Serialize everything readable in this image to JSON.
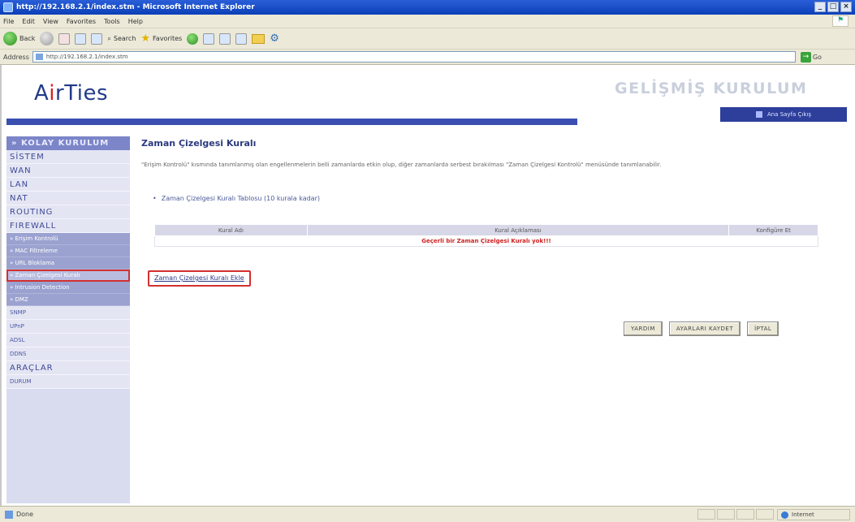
{
  "window": {
    "title": "http://192.168.2.1/index.stm - Microsoft Internet Explorer",
    "controls": [
      "_",
      "□",
      "×"
    ]
  },
  "menu": [
    "File",
    "Edit",
    "View",
    "Favorites",
    "Tools",
    "Help"
  ],
  "toolbar": {
    "back_label": "Back",
    "search_label": "Search",
    "favorites_label": "Favorites"
  },
  "address": {
    "label": "Address",
    "url": "http://192.168.2.1/index.stm",
    "go_label": "Go"
  },
  "brand": {
    "logo_pre": "A",
    "logo_accent": "i",
    "logo_post": "rTies"
  },
  "header": {
    "mode_title": "GELİŞMİŞ KURULUM",
    "badge_text": "Ana Sayfa  Çıkış"
  },
  "sidebar": {
    "head": "» KOLAY KURULUM",
    "items": [
      "SİSTEM",
      "WAN",
      "LAN",
      "NAT",
      "ROUTING",
      "FIREWALL"
    ],
    "firewall_sub": [
      "» Erişim Kontrolü",
      "» MAC Filtreleme",
      "» URL Bloklama",
      "» Zaman Çizelgesi Kuralı",
      "» Intrusion Detection",
      "» DMZ"
    ],
    "items2": [
      "SNMP",
      "UPnP",
      "ADSL",
      "DDNS",
      "ARAÇLAR",
      "DURUM"
    ]
  },
  "content": {
    "title": "Zaman Çizelgesi Kuralı",
    "description": "\"Erişim Kontrolü\" kısmında tanımlanmış olan engellenmelerin belli zamanlarda etkin olup, diğer zamanlarda serbest bırakılması \"Zaman Çizelgesi Kontrolü\" menüsünde tanımlanabilir.",
    "table_caption": "Zaman Çizelgesi Kuralı Tablosu (10 kurala kadar)",
    "table": {
      "headers": [
        "Kural Adı",
        "Kural Açıklaması",
        "Konfigüre Et"
      ],
      "empty_message": "Geçerli bir Zaman Çizelgesi Kuralı yok!!!"
    },
    "add_link": "Zaman Çizelgesi Kuralı Ekle"
  },
  "actions": {
    "help": "YARDIM",
    "save": "AYARLARI KAYDET",
    "cancel": "İPTAL"
  },
  "status": {
    "left": "Done",
    "zone": "Internet"
  }
}
